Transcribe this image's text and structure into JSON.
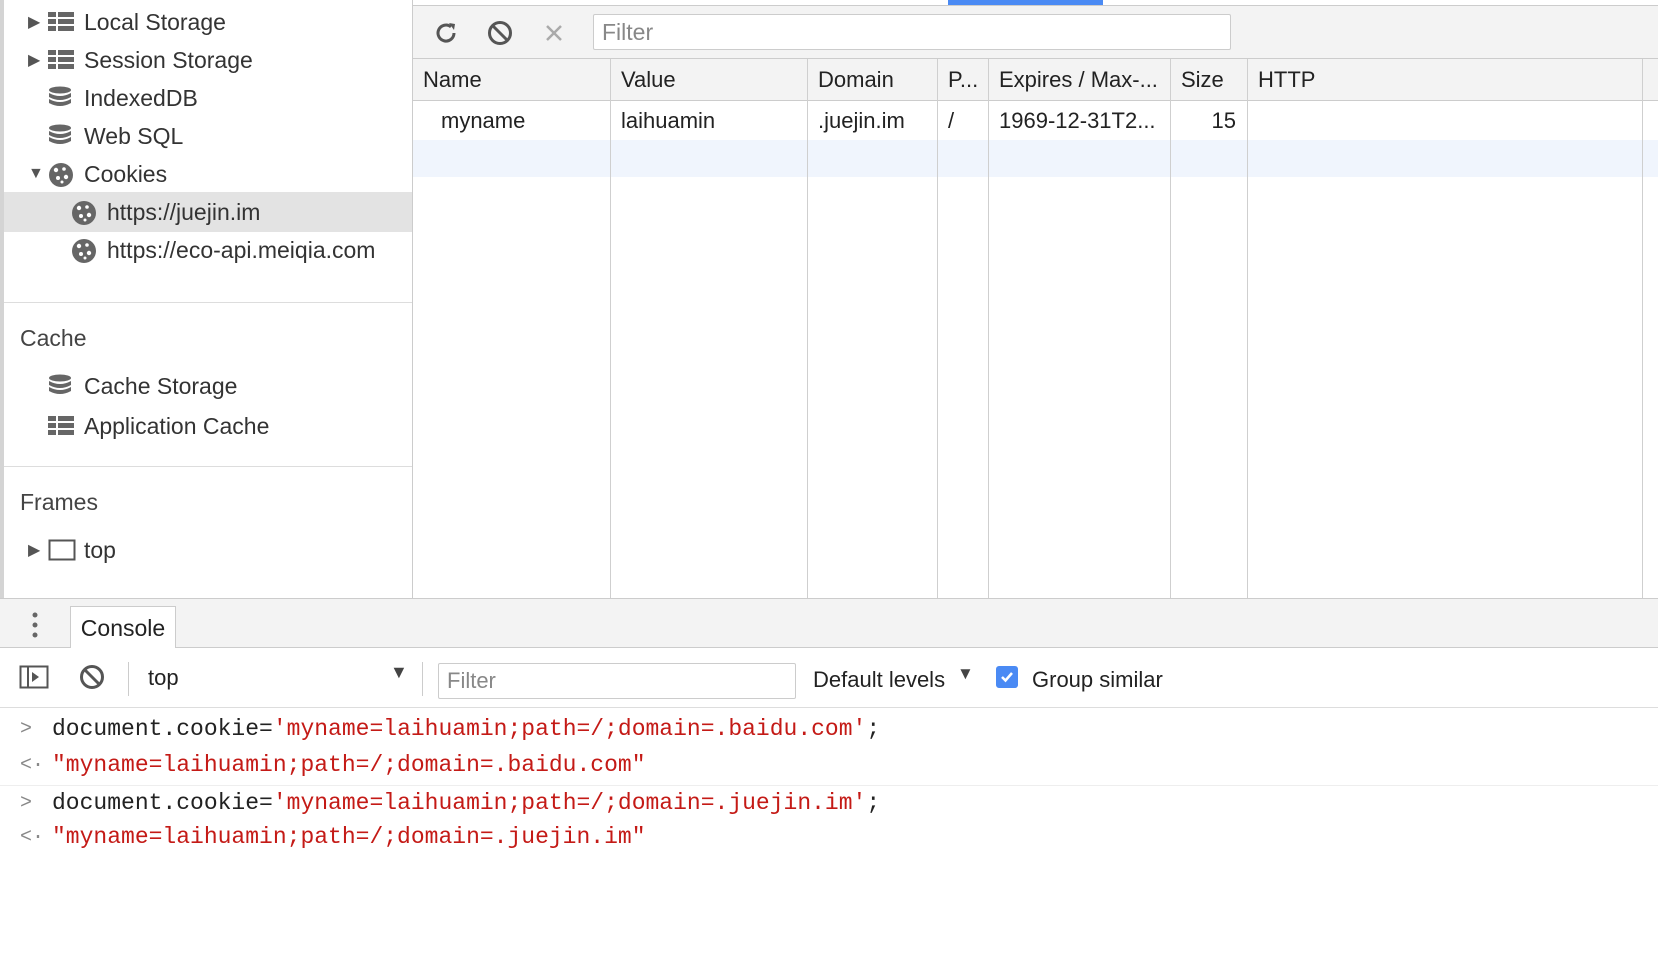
{
  "sidebar": {
    "items": [
      {
        "label": "Local Storage",
        "icon": "grid-table-icon",
        "expander": "▶"
      },
      {
        "label": "Session Storage",
        "icon": "grid-table-icon",
        "expander": "▶"
      },
      {
        "label": "IndexedDB",
        "icon": "database-icon"
      },
      {
        "label": "Web SQL",
        "icon": "database-icon"
      },
      {
        "label": "Cookies",
        "icon": "cookie-icon",
        "expander": "▼"
      },
      {
        "label": "https://juejin.im",
        "icon": "cookie-icon",
        "selected": true
      },
      {
        "label": "https://eco-api.meiqia.com",
        "icon": "cookie-icon"
      }
    ],
    "cache_title": "Cache",
    "cache_items": [
      {
        "label": "Cache Storage",
        "icon": "database-icon"
      },
      {
        "label": "Application Cache",
        "icon": "grid-table-icon"
      }
    ],
    "frames_title": "Frames",
    "frames_items": [
      {
        "label": "top",
        "icon": "frame-window-icon",
        "expander": "▶"
      }
    ]
  },
  "toolbar": {
    "refresh_icon": "refresh-icon",
    "clear_icon": "block-icon",
    "delete_icon": "close-icon",
    "filter_placeholder": "Filter"
  },
  "cookies_table": {
    "columns": [
      "Name",
      "Value",
      "Domain",
      "P...",
      "Expires / Max-...",
      "Size",
      "HTTP"
    ],
    "rows": [
      {
        "name": "myname",
        "value": "laihuamin",
        "domain": ".juejin.im",
        "path": "/",
        "expires": "1969-12-31T2...",
        "size": "15",
        "http": ""
      }
    ]
  },
  "drawer": {
    "tab_label": "Console",
    "context": "top",
    "filter_placeholder": "Filter",
    "levels": "Default levels",
    "group_similar": "Group similar",
    "group_checked": true
  },
  "console": {
    "lines": [
      {
        "prefix": ">",
        "parts": [
          {
            "t": "document.cookie=",
            "c": "kw"
          },
          {
            "t": "'myname=laihuamin;path=/;domain=.baidu.com'",
            "c": "str"
          },
          {
            "t": ";",
            "c": "kw"
          }
        ]
      },
      {
        "prefix": "<·",
        "parts": [
          {
            "t": "\"myname=laihuamin;path=/;domain=.baidu.com\"",
            "c": "str"
          }
        ]
      },
      {
        "prefix": ">",
        "parts": [
          {
            "t": "document.cookie=",
            "c": "kw"
          },
          {
            "t": "'myname=laihuamin;path=/;domain=.juejin.im'",
            "c": "str"
          },
          {
            "t": ";",
            "c": "kw"
          }
        ]
      },
      {
        "prefix": "<·",
        "parts": [
          {
            "t": "\"myname=laihuamin;path=/;domain=.juejin.im\"",
            "c": "str"
          }
        ]
      }
    ]
  },
  "colors": {
    "accent": "#4a8af4",
    "string": "#c41a16",
    "selected_row": "#e3e3e3"
  }
}
